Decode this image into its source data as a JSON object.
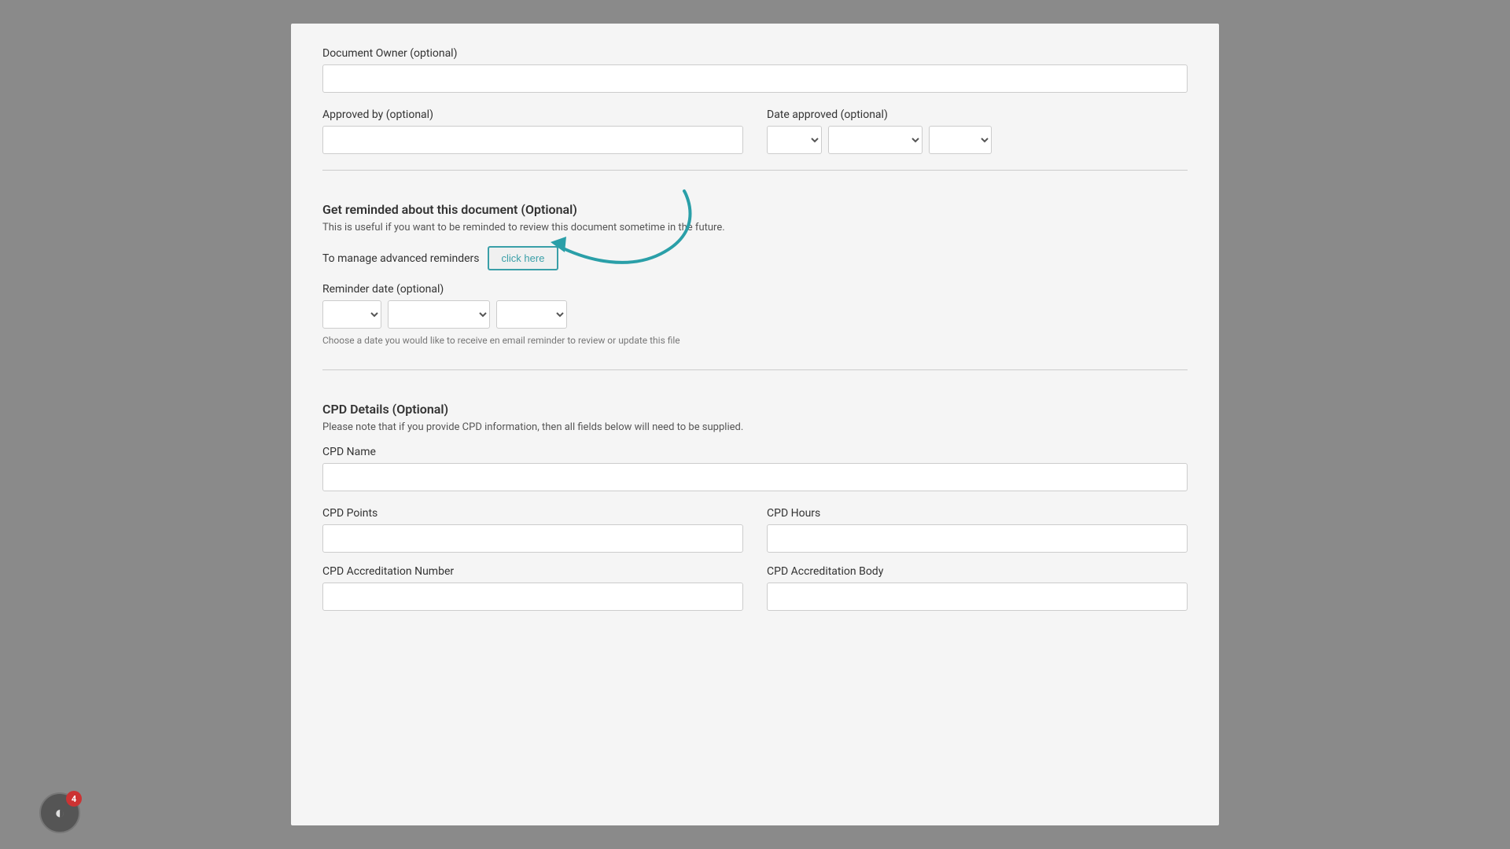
{
  "form": {
    "document_owner": {
      "label": "Document Owner (optional)",
      "placeholder": "",
      "value": ""
    },
    "approved_by": {
      "label": "Approved by (optional)",
      "placeholder": "",
      "value": ""
    },
    "date_approved": {
      "label": "Date approved (optional)"
    },
    "reminder_section": {
      "title": "Get reminded about this document (Optional)",
      "description": "This is useful if you want to be reminded to review this document sometime in the future.",
      "advanced_reminder_text": "To manage advanced reminders",
      "click_here_label": "click here",
      "reminder_date_label": "Reminder date (optional)",
      "reminder_hint": "Choose a date you would like to receive en email reminder to review or update this file"
    },
    "cpd_section": {
      "title": "CPD Details (Optional)",
      "description": "Please note that if you provide CPD information, then all fields below will need to be supplied.",
      "cpd_name_label": "CPD Name",
      "cpd_name_value": "",
      "cpd_points_label": "CPD Points",
      "cpd_points_value": "",
      "cpd_hours_label": "CPD Hours",
      "cpd_hours_value": "",
      "cpd_accreditation_number_label": "CPD Accreditation Number",
      "cpd_accreditation_number_value": "",
      "cpd_accreditation_body_label": "CPD Accreditation Body",
      "cpd_accreditation_body_value": ""
    }
  },
  "notification": {
    "badge_count": "4"
  },
  "colors": {
    "teal": "#3a9fa8",
    "arrow": "#2a9fa8"
  }
}
